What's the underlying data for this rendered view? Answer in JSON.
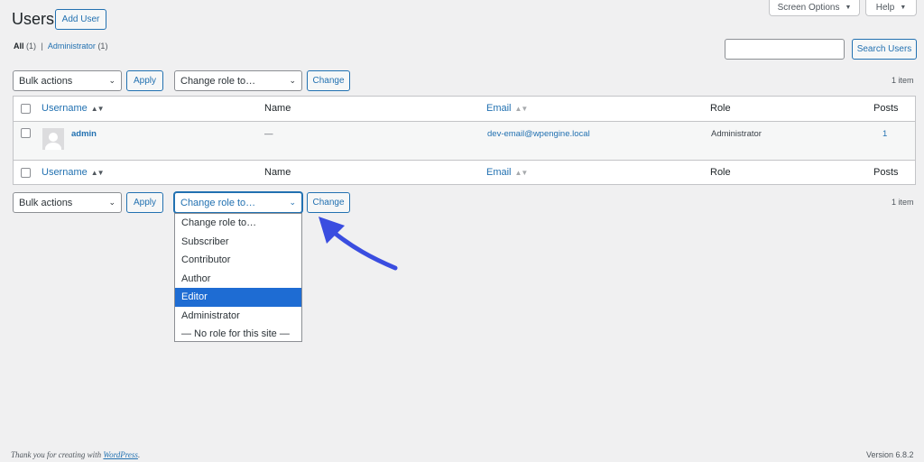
{
  "header": {
    "title": "Users",
    "add_user": "Add User",
    "screen_options": "Screen Options",
    "help": "Help"
  },
  "views": {
    "all_label": "All",
    "all_count": "(1)",
    "separator": "|",
    "admin_label": "Administrator",
    "admin_count": "(1)"
  },
  "search": {
    "placeholder": "",
    "button": "Search Users"
  },
  "tablenav_top": {
    "bulk_actions": "Bulk actions",
    "apply": "Apply",
    "change_role": "Change role to…",
    "change": "Change",
    "count": "1 item"
  },
  "tablenav_bottom": {
    "bulk_actions": "Bulk actions",
    "apply": "Apply",
    "change_role": "Change role to…",
    "change": "Change",
    "count": "1 item"
  },
  "table": {
    "columns": [
      "Username",
      "Name",
      "Email",
      "Role",
      "Posts"
    ],
    "rows": [
      {
        "username": "admin",
        "name": "—",
        "email": "dev-email@wpengine.local",
        "role": "Administrator",
        "posts": "1"
      }
    ]
  },
  "role_dropdown": {
    "options": [
      "Change role to…",
      "Subscriber",
      "Contributor",
      "Author",
      "Editor",
      "Administrator",
      "— No role for this site —"
    ],
    "highlighted": "Editor"
  },
  "annotation": {
    "arrow_color": "#3a4de0"
  },
  "colors": {
    "accent": "#2271b1",
    "highlight": "#1e6cd3",
    "background": "#f0f0f1"
  },
  "footer": {
    "thanks_prefix": "Thank you for creating with ",
    "wordpress": "WordPress",
    "thanks_suffix": ".",
    "version": "Version 6.8.2"
  }
}
